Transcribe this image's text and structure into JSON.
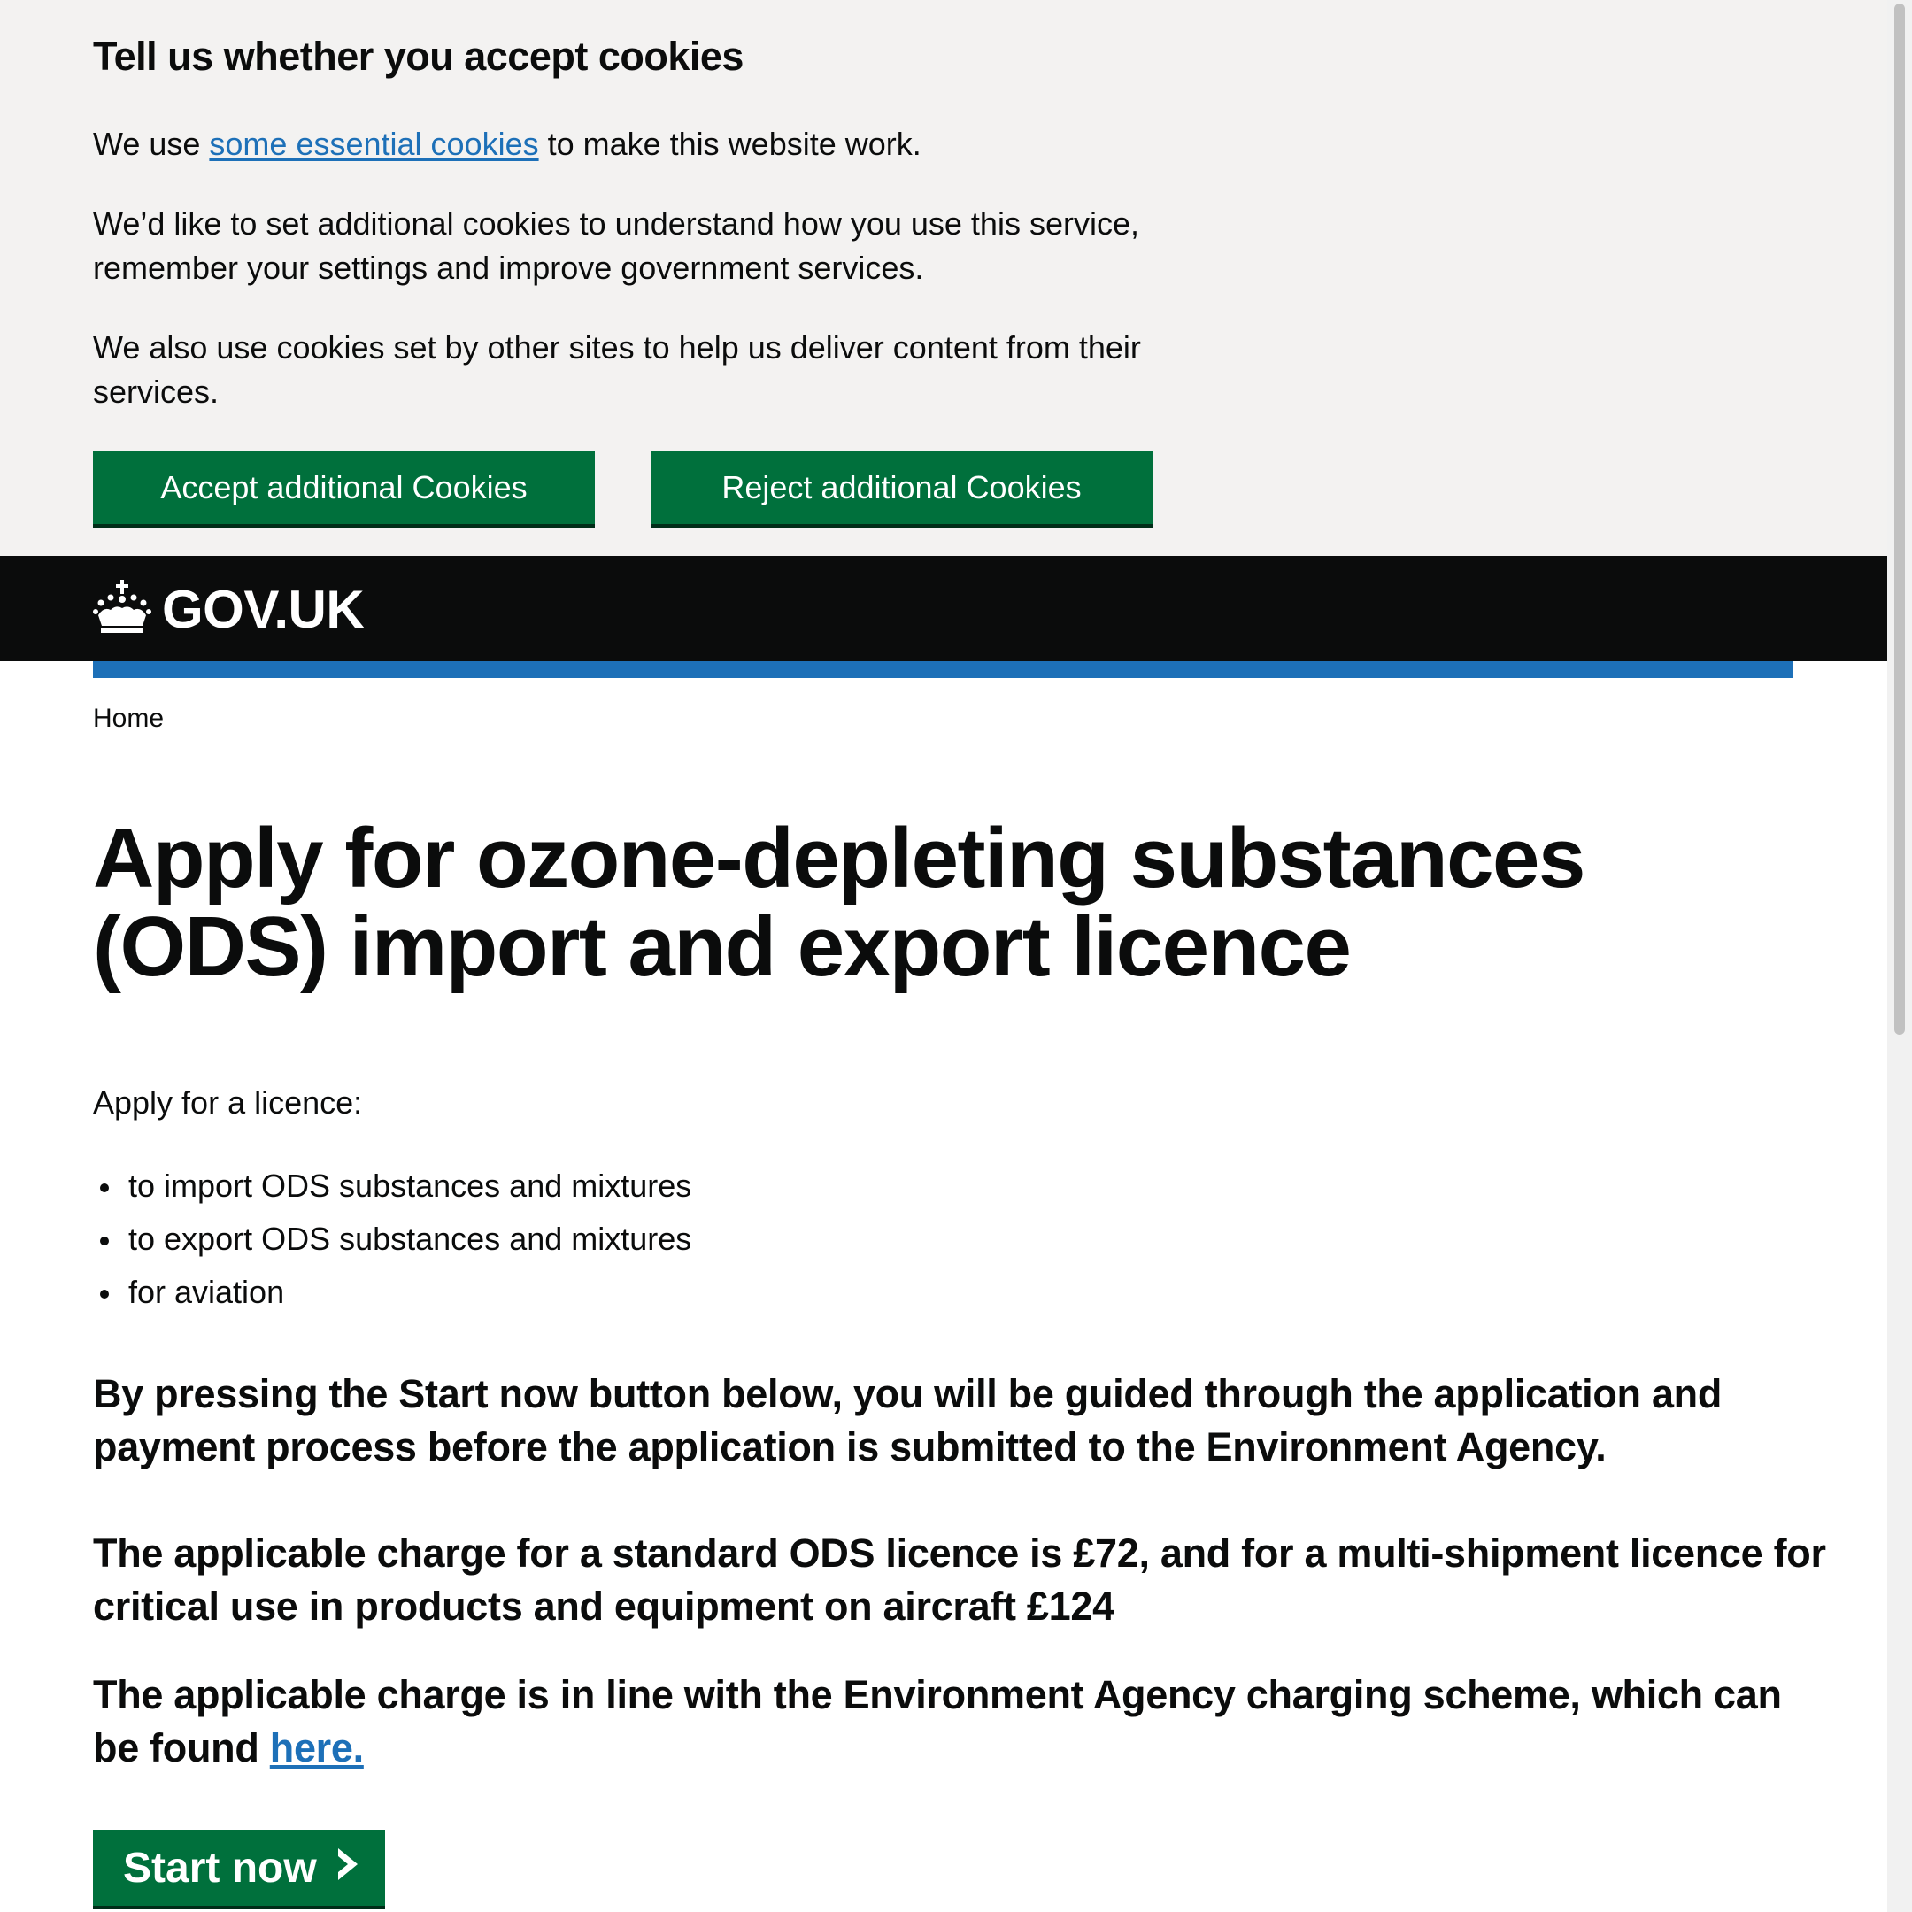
{
  "cookie_banner": {
    "title": "Tell us whether you accept cookies",
    "p1_before": "We use ",
    "p1_link": "some essential cookies",
    "p1_after": " to make this website work.",
    "p2": "We’d like to set additional cookies to understand how you use this service, remember your settings and improve government services.",
    "p3": "We also use cookies set by other sites to help us deliver content from their services.",
    "accept_label": "Accept additional Cookies",
    "reject_label": "Reject additional Cookies",
    "background_color": "#f3f2f1",
    "button_color": "#00703c"
  },
  "header": {
    "logo_text": "GOV.UK",
    "logo_icon": "crown-icon",
    "background_color": "#0b0c0c",
    "accent_color": "#1d70b8"
  },
  "breadcrumb": {
    "home": "Home"
  },
  "main": {
    "title": "Apply for ozone-depleting substances (ODS) import and export licence",
    "intro": "Apply for a licence:",
    "bullets": [
      "to import ODS substances and mixtures",
      "to export ODS substances and mixtures",
      "for aviation"
    ],
    "guidance": "By pressing the Start now button below, you will be guided through the application and payment process before the application is submitted to the Environment Agency.",
    "charge": "The applicable charge for a standard ODS licence is £72, and for a multi-shipment licence for critical use in products and equipment on aircraft £124",
    "scheme_text": "The applicable charge is in line with the Environment Agency charging scheme, which can be found ",
    "scheme_link": "here.",
    "start_label": "Start now",
    "start_icon": "chevron-right-icon"
  }
}
